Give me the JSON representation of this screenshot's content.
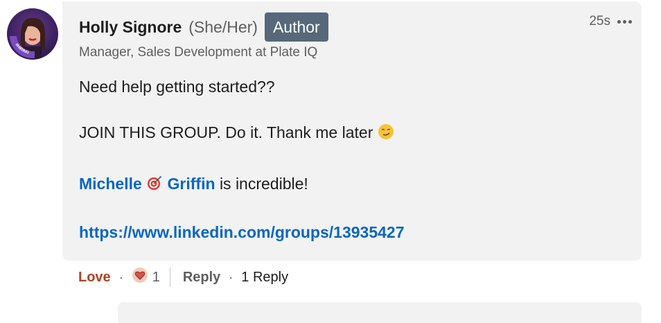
{
  "comment": {
    "author": {
      "name": "Holly Signore",
      "pronouns": "(She/Her)",
      "badge": "Author",
      "headline": "Manager, Sales Development at Plate IQ",
      "avatar_ring_text": "#HIRING"
    },
    "timestamp": "25s",
    "body": {
      "line1": "Need help getting started??",
      "line2": "JOIN THIS GROUP. Do it. Thank me later",
      "mention_first": "Michelle",
      "mention_last": "Griffin",
      "line3_suffix": " is incredible!",
      "link": "https://www.linkedin.com/groups/13935427"
    },
    "icons": {
      "more": "more-icon",
      "smirk": "smirk-emoji-icon",
      "target": "target-icon",
      "love_reaction": "heart-reaction-icon"
    },
    "actions": {
      "love_label": "Love",
      "reaction_count": "1",
      "reply_label": "Reply",
      "replies_label": "1 Reply"
    }
  },
  "colors": {
    "bubble_bg": "#f2f2f2",
    "link": "#0a66c2",
    "love": "#b24020",
    "badge_bg": "#56687a"
  }
}
